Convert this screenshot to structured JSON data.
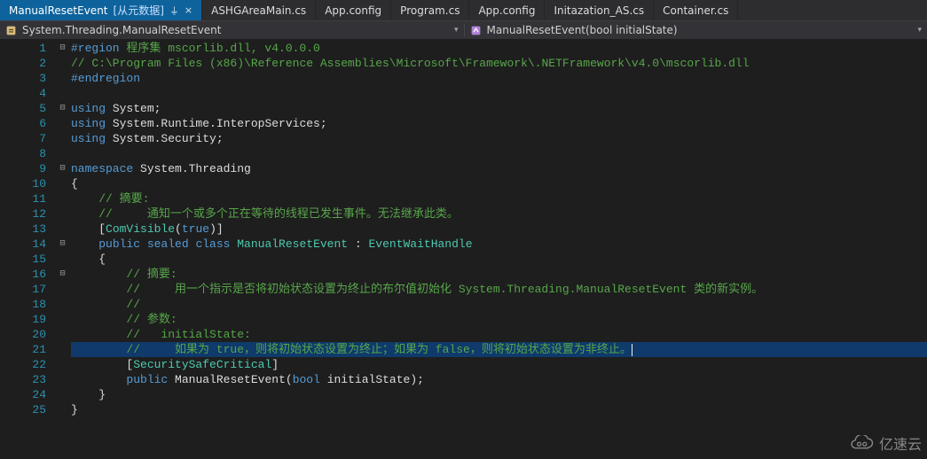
{
  "tabs": [
    {
      "label": "ManualResetEvent",
      "suffix": "[从元数据]",
      "active": true,
      "pinned": true,
      "closeable": true
    },
    {
      "label": "ASHGAreaMain.cs"
    },
    {
      "label": "App.config"
    },
    {
      "label": "Program.cs"
    },
    {
      "label": "App.config"
    },
    {
      "label": "Initazation_AS.cs"
    },
    {
      "label": "Container.cs"
    }
  ],
  "nav": {
    "left_text": "System.Threading.ManualResetEvent",
    "right_text": "ManualResetEvent(bool initialState)"
  },
  "watermark": "亿速云",
  "code": {
    "l1a": "#region",
    "l1b": " 程序集 mscorlib.dll, v4.0.0.0",
    "l2": "// C:\\Program Files (x86)\\Reference Assemblies\\Microsoft\\Framework\\.NETFramework\\v4.0\\mscorlib.dll",
    "l3": "#endregion",
    "l5_using": "using",
    "l5_ns": " System",
    "l5_sc": ";",
    "l6_using": "using",
    "l6_ns": " System.Runtime.InteropServices",
    "l6_sc": ";",
    "l7_using": "using",
    "l7_ns": " System.Security",
    "l7_sc": ";",
    "l9_ns_kw": "namespace",
    "l9_ns": " System.Threading",
    "l10": "{",
    "l11": "    // 摘要:",
    "l12": "    //     通知一个或多个正在等待的线程已发生事件。无法继承此类。",
    "l13_a": "    [",
    "l13_b": "ComVisible",
    "l13_c": "(",
    "l13_d": "true",
    "l13_e": ")]",
    "l14_a": "    ",
    "l14_public": "public",
    "l14_sealed": " sealed",
    "l14_class": " class",
    "l14_name": " ManualResetEvent",
    "l14_colon": " : ",
    "l14_base": "EventWaitHandle",
    "l15": "    {",
    "l16": "        // 摘要:",
    "l17": "        //     用一个指示是否将初始状态设置为终止的布尔值初始化 System.Threading.ManualResetEvent 类的新实例。",
    "l18": "        //",
    "l19": "        // 参数:",
    "l20": "        //   initialState:",
    "l21": "        //     如果为 true，则将初始状态设置为终止；如果为 false，则将初始状态设置为非终止。",
    "l22_a": "        [",
    "l22_b": "SecuritySafeCritical",
    "l22_c": "]",
    "l23_a": "        ",
    "l23_public": "public",
    "l23_sp": " ",
    "l23_name": "ManualResetEvent",
    "l23_op": "(",
    "l23_bool": "bool",
    "l23_param": " initialState",
    "l23_cp": ")",
    "l23_sc": ";",
    "l24": "    }",
    "l25": "}"
  },
  "line_count": 25,
  "fold": {
    "1": "⊟",
    "5": "⊟",
    "9": "⊟",
    "14": "⊟",
    "16": "⊟"
  }
}
